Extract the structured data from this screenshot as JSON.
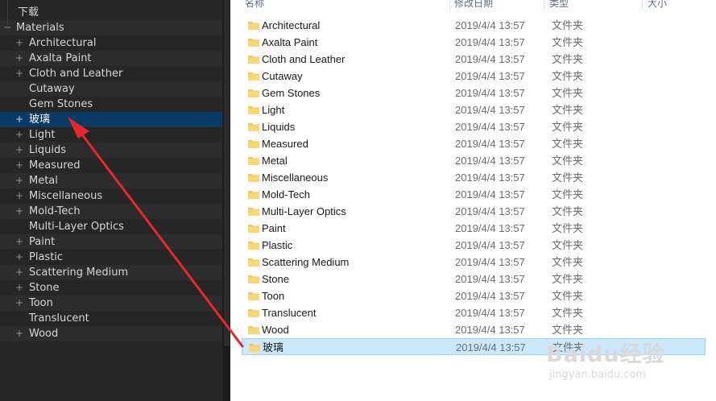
{
  "tree": {
    "top_item": "下载",
    "root": {
      "label": "Materials",
      "toggle": "−"
    },
    "items": [
      {
        "label": "Architectural",
        "toggle": "+"
      },
      {
        "label": "Axalta Paint",
        "toggle": "+"
      },
      {
        "label": "Cloth and Leather",
        "toggle": "+"
      },
      {
        "label": "Cutaway",
        "toggle": ""
      },
      {
        "label": "Gem Stones",
        "toggle": ""
      },
      {
        "label": "玻璃",
        "toggle": "+",
        "selected": true
      },
      {
        "label": "Light",
        "toggle": "+"
      },
      {
        "label": "Liquids",
        "toggle": "+"
      },
      {
        "label": "Measured",
        "toggle": "+"
      },
      {
        "label": "Metal",
        "toggle": "+"
      },
      {
        "label": "Miscellaneous",
        "toggle": "+"
      },
      {
        "label": "Mold-Tech",
        "toggle": "+"
      },
      {
        "label": "Multi-Layer Optics",
        "toggle": ""
      },
      {
        "label": "Paint",
        "toggle": "+"
      },
      {
        "label": "Plastic",
        "toggle": "+"
      },
      {
        "label": "Scattering Medium",
        "toggle": "+"
      },
      {
        "label": "Stone",
        "toggle": "+"
      },
      {
        "label": "Toon",
        "toggle": "+"
      },
      {
        "label": "Translucent",
        "toggle": ""
      },
      {
        "label": "Wood",
        "toggle": "+"
      }
    ]
  },
  "explorer": {
    "columns": [
      "名称",
      "修改日期",
      "类型",
      "大小"
    ],
    "files": [
      {
        "name": "Architectural",
        "date": "2019/4/4 13:57",
        "type": "文件夹"
      },
      {
        "name": "Axalta Paint",
        "date": "2019/4/4 13:57",
        "type": "文件夹"
      },
      {
        "name": "Cloth and Leather",
        "date": "2019/4/4 13:57",
        "type": "文件夹"
      },
      {
        "name": "Cutaway",
        "date": "2019/4/4 13:57",
        "type": "文件夹"
      },
      {
        "name": "Gem Stones",
        "date": "2019/4/4 13:57",
        "type": "文件夹"
      },
      {
        "name": "Light",
        "date": "2019/4/4 13:57",
        "type": "文件夹"
      },
      {
        "name": "Liquids",
        "date": "2019/4/4 13:57",
        "type": "文件夹"
      },
      {
        "name": "Measured",
        "date": "2019/4/4 13:57",
        "type": "文件夹"
      },
      {
        "name": "Metal",
        "date": "2019/4/4 13:57",
        "type": "文件夹"
      },
      {
        "name": "Miscellaneous",
        "date": "2019/4/4 13:57",
        "type": "文件夹"
      },
      {
        "name": "Mold-Tech",
        "date": "2019/4/4 13:57",
        "type": "文件夹"
      },
      {
        "name": "Multi-Layer Optics",
        "date": "2019/4/4 13:57",
        "type": "文件夹"
      },
      {
        "name": "Paint",
        "date": "2019/4/4 13:57",
        "type": "文件夹"
      },
      {
        "name": "Plastic",
        "date": "2019/4/4 13:57",
        "type": "文件夹"
      },
      {
        "name": "Scattering Medium",
        "date": "2019/4/4 13:57",
        "type": "文件夹"
      },
      {
        "name": "Stone",
        "date": "2019/4/4 13:57",
        "type": "文件夹"
      },
      {
        "name": "Toon",
        "date": "2019/4/4 13:57",
        "type": "文件夹"
      },
      {
        "name": "Translucent",
        "date": "2019/4/4 13:57",
        "type": "文件夹"
      },
      {
        "name": "Wood",
        "date": "2019/4/4 13:57",
        "type": "文件夹"
      },
      {
        "name": "玻璃",
        "date": "2019/4/4 13:57",
        "type": "文件夹",
        "selected": true
      }
    ]
  },
  "annotation": {
    "color": "#e8262d"
  },
  "watermark": {
    "logo": "Baidu经验",
    "url": "jingyan.baidu.com"
  },
  "colors": {
    "tree_bg": "#262626",
    "tree_selected": "#0a3a66",
    "file_selected": "#cce8ff",
    "folder_icon": "#f3c85f"
  },
  "icons": {
    "folder": "folder-icon",
    "arrow": "arrow-annotation",
    "tree_toggle": "expand-toggle-icon"
  }
}
